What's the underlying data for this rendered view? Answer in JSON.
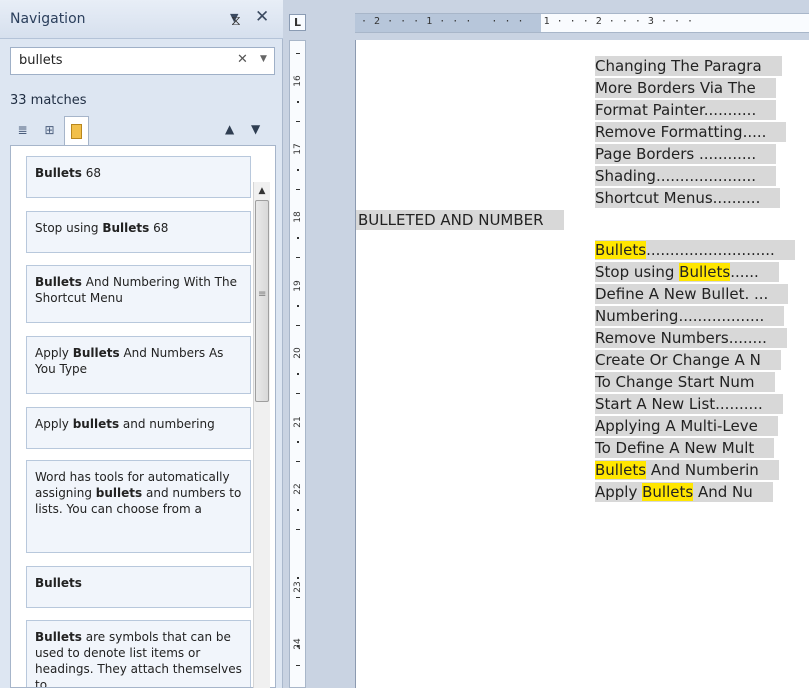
{
  "nav": {
    "title": "Navigation",
    "dropdown_icon": "▼",
    "close_icon": "✕",
    "search": {
      "value": "bullets",
      "clear_icon": "✕",
      "options_icon": "▼"
    },
    "match_count": "33 matches",
    "prev_icon": "▲",
    "next_icon": "▼",
    "tab_icons": {
      "headings": "≣",
      "pages": "⊞"
    }
  },
  "results": [
    {
      "bold": "Bullets",
      "after": " 68"
    },
    {
      "before": "Stop using ",
      "bold": "Bullets",
      "after": " 68"
    },
    {
      "bold": "Bullets",
      "after": " And Numbering With The Shortcut Menu"
    },
    {
      "before": "Apply ",
      "bold": "Bullets",
      "after": " And Numbers As You Type"
    },
    {
      "before": "Apply ",
      "bold": "bullets",
      "after": " and numbering"
    },
    {
      "before": "Word has tools for automatically assigning ",
      "bold": "bullets",
      "after": " and numbers to lists. You can choose from a"
    },
    {
      "bold": "Bullets"
    },
    {
      "bold": "Bullets",
      "after": " are symbols that can be used to denote list items or headings.  They attach themselves to"
    }
  ],
  "scroll": {
    "up_icon": "▲",
    "grip_icon": "≡"
  },
  "ruler": {
    "toggle": "L",
    "horizontal_text": "· 2 · · · 1 · · ·   · · ·   1 · · · 2 · · · 3 · · ·",
    "indent_icon": "⧖",
    "vertical_numbers": [
      "16",
      "17",
      "18",
      "19",
      "20",
      "21",
      "22",
      "23",
      "24"
    ]
  },
  "document": {
    "toc_top": [
      "Changing The Paragra",
      "More Borders Via The",
      "Format Painter...........",
      "Remove Formatting.....",
      "Page Borders ............",
      "Shading.....................",
      "Shortcut Menus.........."
    ],
    "section_heading": "BULLETED AND NUMBER",
    "toc_bottom": [
      {
        "hl": "Bullets",
        "rest": "..........................."
      },
      {
        "pre": "Stop using ",
        "hl": "Bullets",
        "rest": "......"
      },
      {
        "rest": "Define A New Bullet. ..."
      },
      {
        "rest": "Numbering.................."
      },
      {
        "rest": "Remove Numbers........"
      },
      {
        "rest": "Create Or Change A N"
      },
      {
        "rest": "To Change Start Num"
      },
      {
        "rest": "Start A New List.........."
      },
      {
        "rest": "Applying A Multi-Leve"
      },
      {
        "rest": "To Define A New Mult"
      },
      {
        "hl": "Bullets",
        "rest": " And Numberin"
      },
      {
        "pre": "Apply ",
        "hl": "Bullets",
        "rest": " And Nu"
      }
    ]
  },
  "colors": {
    "search_highlight": "#ffe600",
    "toc_shading": "#d8d8d8",
    "pane_background": "#dde6f2"
  }
}
